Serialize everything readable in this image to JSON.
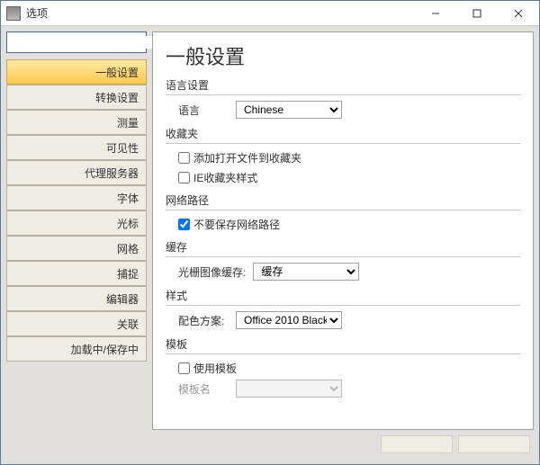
{
  "window": {
    "title": "选项"
  },
  "search": {
    "placeholder": ""
  },
  "sidebar": {
    "items": [
      {
        "label": "一般设置",
        "selected": true
      },
      {
        "label": "转换设置",
        "selected": false
      },
      {
        "label": "测量",
        "selected": false
      },
      {
        "label": "可见性",
        "selected": false
      },
      {
        "label": "代理服务器",
        "selected": false
      },
      {
        "label": "字体",
        "selected": false
      },
      {
        "label": "光标",
        "selected": false
      },
      {
        "label": "网格",
        "selected": false
      },
      {
        "label": "捕捉",
        "selected": false
      },
      {
        "label": "编辑器",
        "selected": false
      },
      {
        "label": "关联",
        "selected": false
      },
      {
        "label": "加载中/保存中",
        "selected": false
      }
    ]
  },
  "page": {
    "title": "一般设置",
    "lang_group": "语言设置",
    "lang_label": "语言",
    "lang_value": "Chinese",
    "fav_group": "收藏夹",
    "fav_add": "添加打开文件到收藏夹",
    "fav_add_checked": false,
    "fav_ie": "IE收藏夹样式",
    "fav_ie_checked": false,
    "net_group": "网络路径",
    "net_nosave": "不要保存网络路径",
    "net_nosave_checked": true,
    "cache_group": "缓存",
    "cache_label": "光栅图像缓存:",
    "cache_value": "缓存",
    "style_group": "样式",
    "style_label": "配色方案:",
    "style_value": "Office 2010 Black",
    "tmpl_group": "模板",
    "tmpl_use": "使用模板",
    "tmpl_use_checked": false,
    "tmpl_name_label": "模板名",
    "tmpl_name_value": ""
  }
}
